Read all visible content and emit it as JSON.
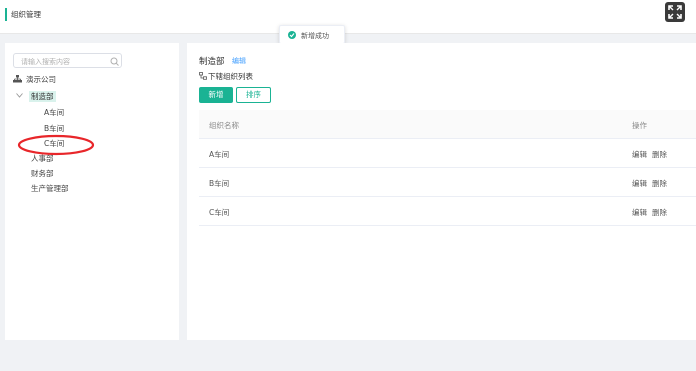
{
  "header": {
    "title": "组织管理"
  },
  "toast": {
    "message": "新增成功"
  },
  "search": {
    "placeholder": "请输入搜索内容"
  },
  "tree": {
    "root": "演示公司",
    "expanded_node": "制造部",
    "children": [
      "A车间",
      "B车间",
      "C车间"
    ],
    "siblings": [
      "人事部",
      "财务部",
      "生产管理部"
    ]
  },
  "panel": {
    "dept_name": "制造部",
    "edit_label": "编辑",
    "sub_list_label": "下辖组织列表",
    "add_label": "新增",
    "sort_label": "排序"
  },
  "table": {
    "columns": [
      "组织名称",
      "操作"
    ],
    "rows": [
      {
        "name": "A车间",
        "edit": "编辑",
        "delete": "删除"
      },
      {
        "name": "B车间",
        "edit": "编辑",
        "delete": "删除"
      },
      {
        "name": "C车间",
        "edit": "编辑",
        "delete": "删除"
      }
    ]
  },
  "colors": {
    "accent": "#1ab394",
    "link": "#409eff",
    "annotation": "#e8262a"
  }
}
